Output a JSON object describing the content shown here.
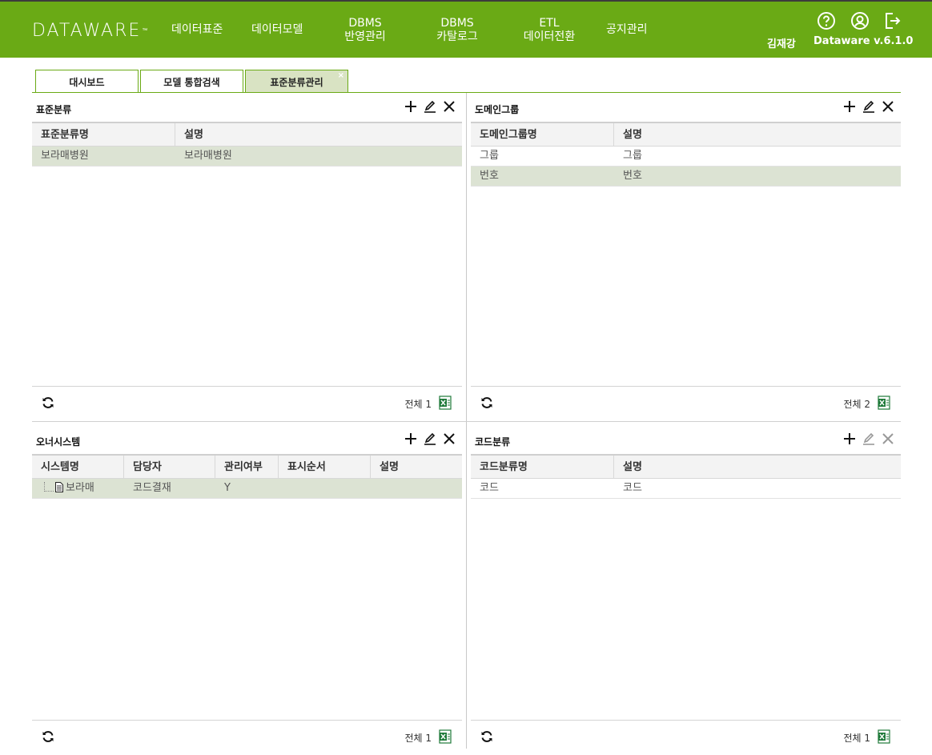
{
  "header": {
    "logo": "DATAWARE",
    "logo_tm": "™",
    "menu": [
      {
        "line1": "데이터표준",
        "line2": ""
      },
      {
        "line1": "데이터모델",
        "line2": ""
      },
      {
        "line1": "DBMS",
        "line2": "반영관리"
      },
      {
        "line1": "DBMS",
        "line2": "카탈로그"
      },
      {
        "line1": "ETL",
        "line2": "데이터전환"
      },
      {
        "line1": "공지관리",
        "line2": ""
      }
    ],
    "user": "김재강",
    "version": "Dataware v.6.1.0",
    "icons": [
      "help-icon",
      "user-icon",
      "logout-icon"
    ]
  },
  "tabs": [
    {
      "label": "대시보드",
      "active": false
    },
    {
      "label": "모델 통합검색",
      "active": false
    },
    {
      "label": "표준분류관리",
      "active": true,
      "close": "×"
    }
  ],
  "panels": {
    "std": {
      "title": "표준분류",
      "columns": [
        "표준분류명",
        "설명"
      ],
      "rows": [
        [
          "보라매병원",
          "보라매병원"
        ]
      ],
      "total": "전체 1"
    },
    "domain": {
      "title": "도메인그룹",
      "columns": [
        "도메인그룹명",
        "설명"
      ],
      "rows": [
        [
          "그룹",
          "그룹"
        ],
        [
          "번호",
          "번호"
        ]
      ],
      "total": "전체 2"
    },
    "owner": {
      "title": "오너시스템",
      "columns": [
        "시스템명",
        "담당자",
        "관리여부",
        "표시순서",
        "설명"
      ],
      "rows": [
        [
          "보라매",
          "코드결재",
          "Y",
          "",
          ""
        ]
      ],
      "total": "전체 1"
    },
    "code": {
      "title": "코드분류",
      "columns": [
        "코드분류명",
        "설명"
      ],
      "rows": [
        [
          "코드",
          "코드"
        ]
      ],
      "total": "전체 1"
    }
  },
  "colors": {
    "header_bg": "#6aaa15",
    "selected_row": "#dce3d3",
    "active_tab": "#d9e3c3"
  }
}
